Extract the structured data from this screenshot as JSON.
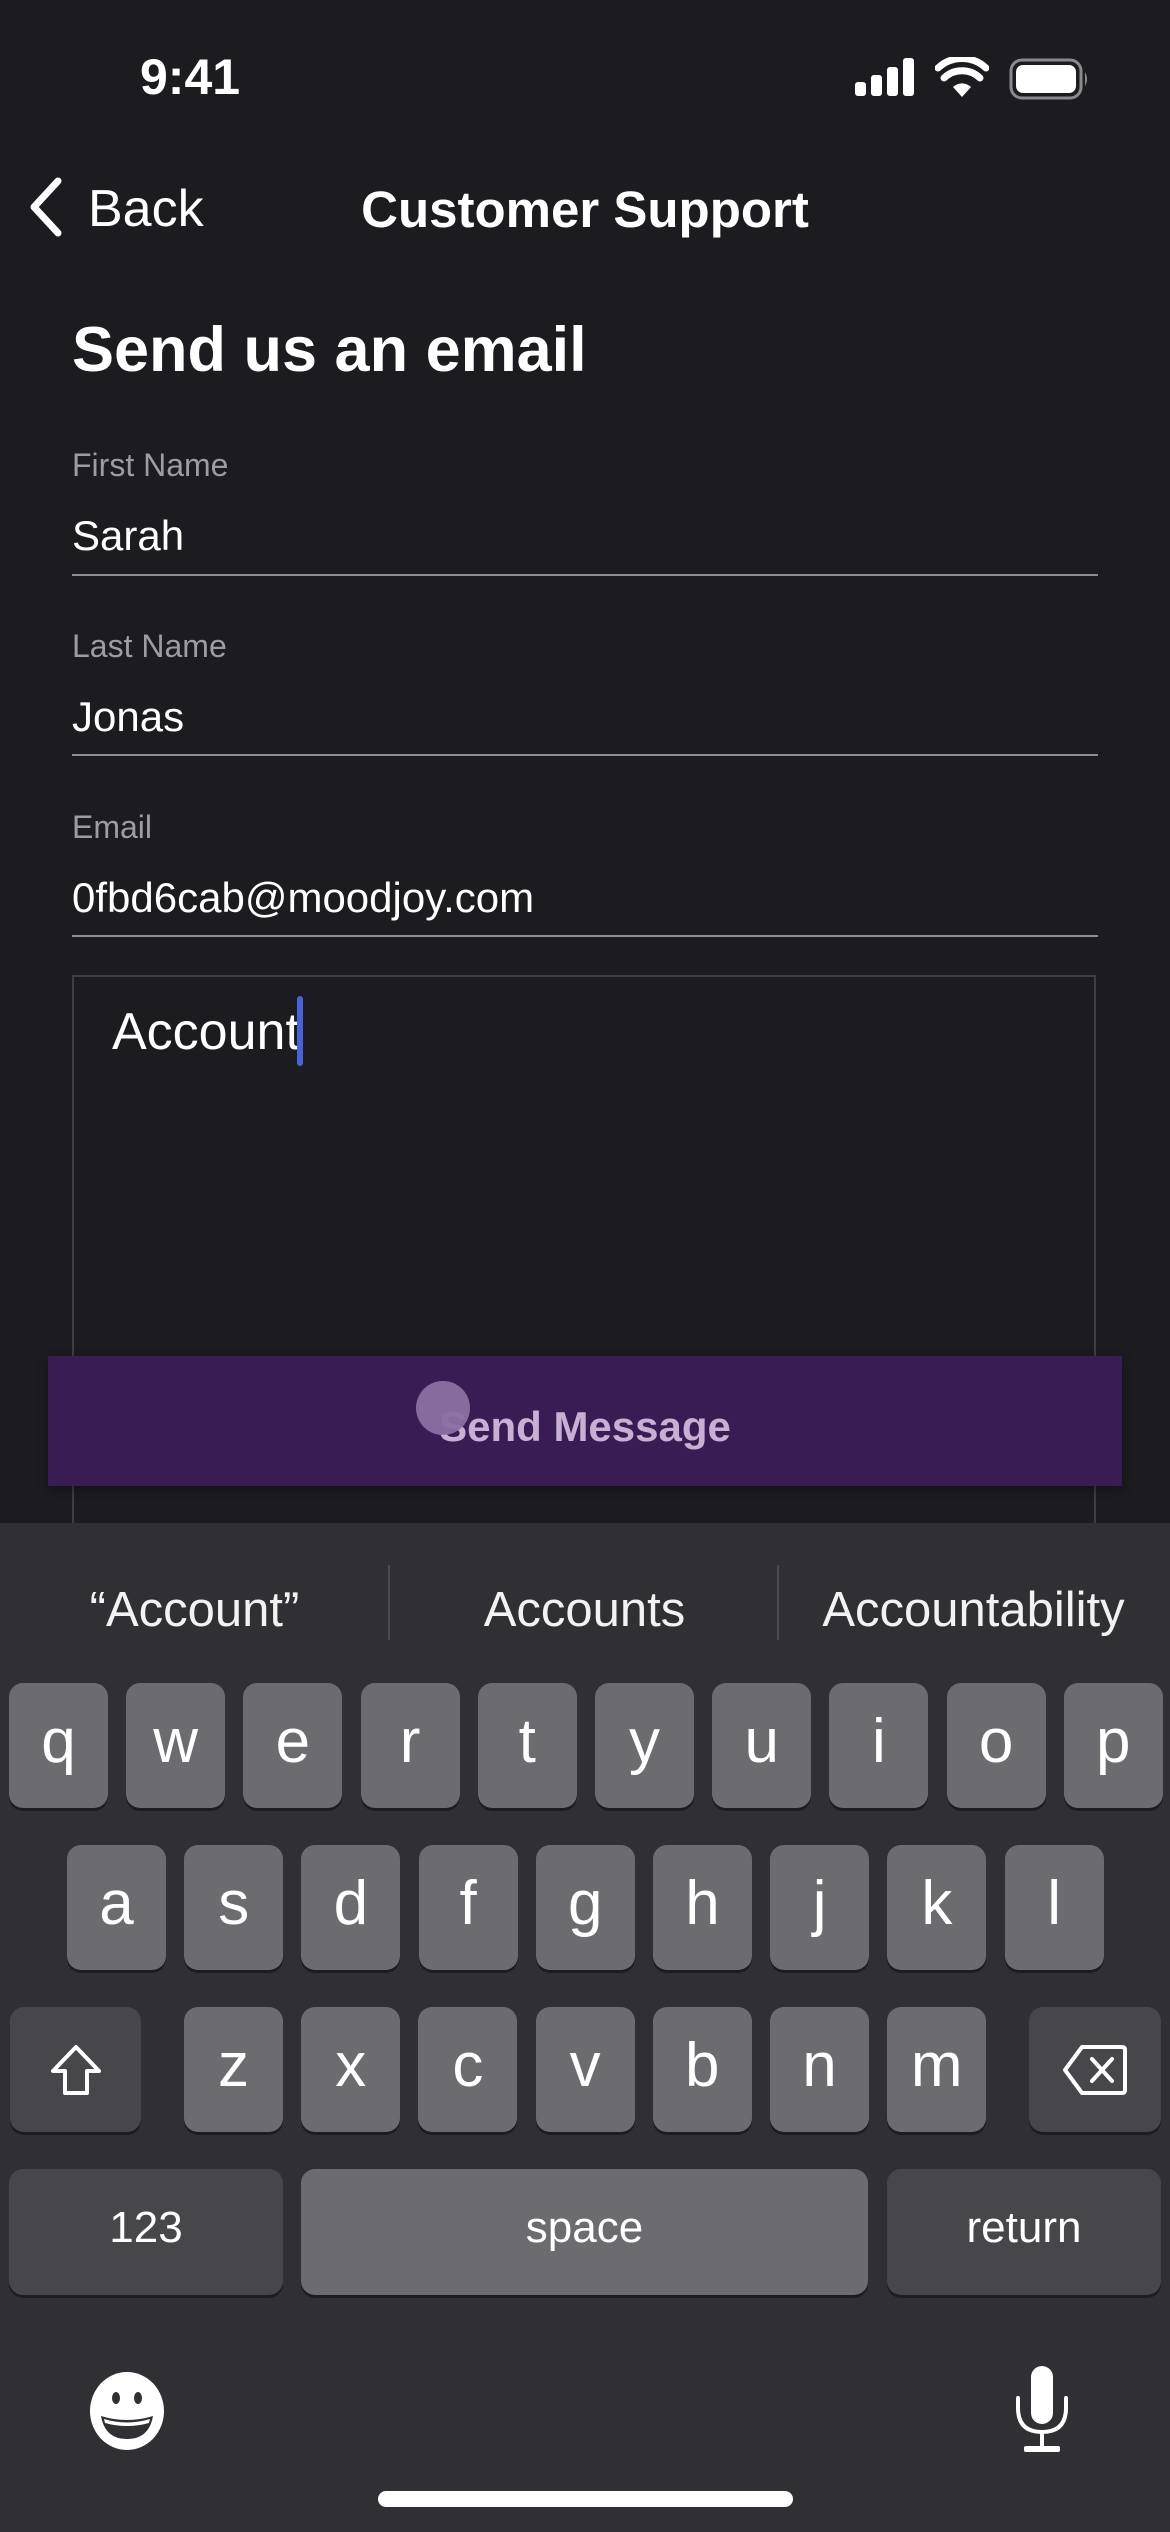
{
  "status_bar": {
    "time": "9:41",
    "icons": [
      "cellular-signal-icon",
      "wifi-icon",
      "battery-icon"
    ]
  },
  "nav": {
    "back_label": "Back",
    "back_icon": "chevron-left-icon",
    "title": "Customer Support"
  },
  "form": {
    "title": "Send us an email",
    "fields": [
      {
        "label": "First Name",
        "value": "Sarah"
      },
      {
        "label": "Last Name",
        "value": "Jonas"
      },
      {
        "label": "Email",
        "value": "0fbd6cab@moodjoy.com"
      }
    ],
    "message": {
      "value": "Account"
    },
    "submit_label": "Send Message"
  },
  "colors": {
    "background": "#1c1b20",
    "button": "#3a1c55",
    "button_text": "#c6b0d4",
    "cursor": "#4a62d8",
    "keyboard": "#302f34",
    "key": "#6c6b70",
    "key_dark": "#47464b"
  },
  "keyboard": {
    "suggestions": [
      "“Account”",
      "Accounts",
      "Accountability"
    ],
    "row1": [
      "q",
      "w",
      "e",
      "r",
      "t",
      "y",
      "u",
      "i",
      "o",
      "p"
    ],
    "row2": [
      "a",
      "s",
      "d",
      "f",
      "g",
      "h",
      "j",
      "k",
      "l"
    ],
    "row3": [
      "z",
      "x",
      "c",
      "v",
      "b",
      "n",
      "m"
    ],
    "shift_icon": "shift-icon",
    "delete_icon": "delete-backward-icon",
    "numbers_label": "123",
    "space_label": "space",
    "return_label": "return",
    "emoji_icon": "emoji-icon",
    "mic_icon": "microphone-icon"
  }
}
